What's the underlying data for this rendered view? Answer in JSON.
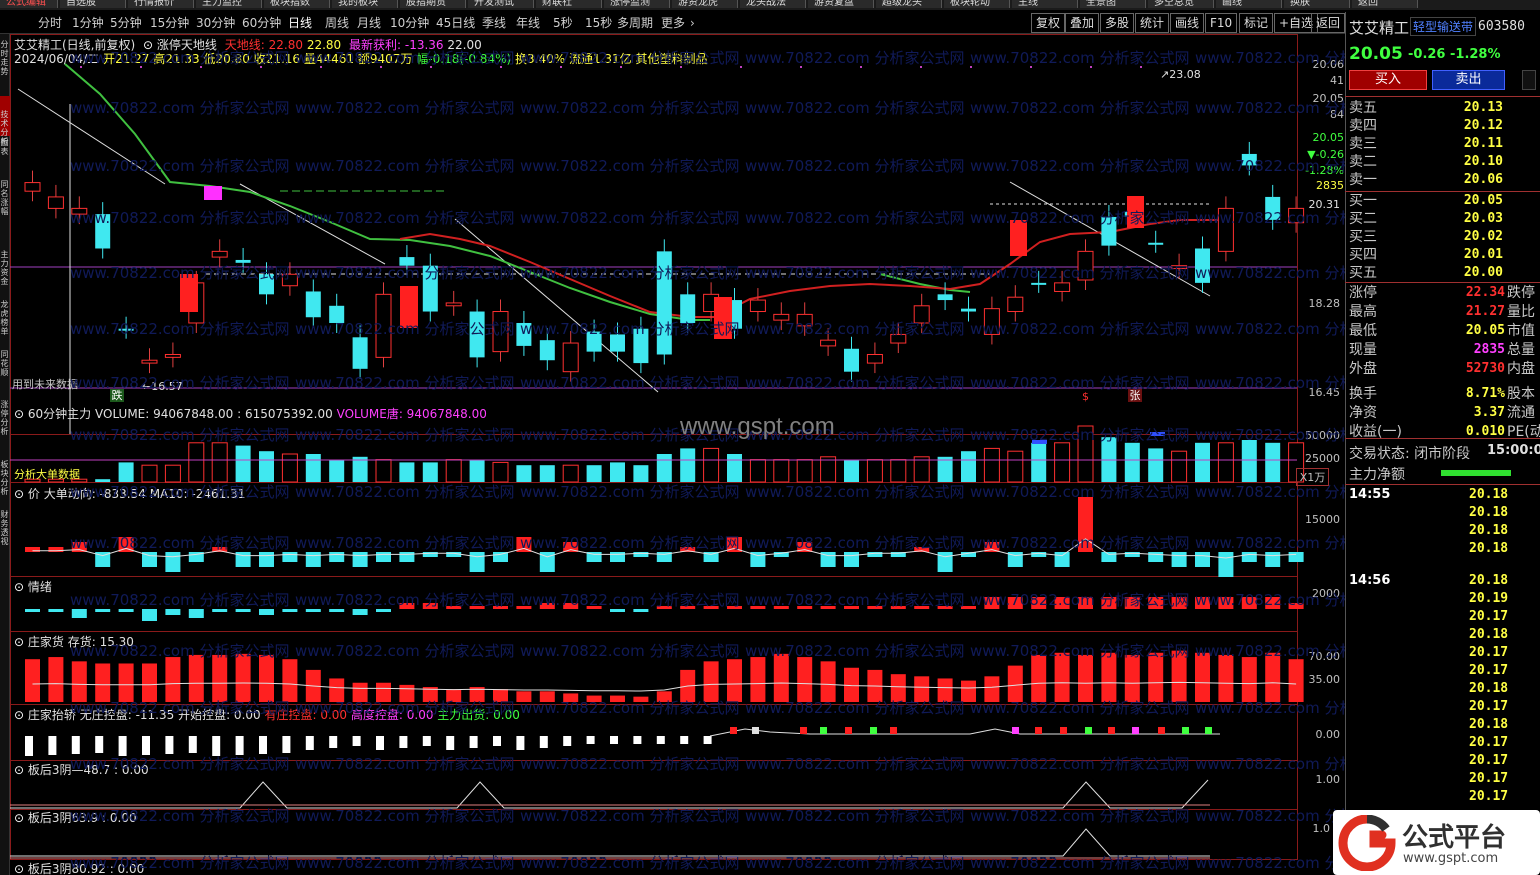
{
  "top_menu": [
    "公式编辑",
    "自选股",
    "行情报价",
    "主力监控",
    "板块指数",
    "我的板块",
    "股指期货",
    "开发测试",
    "财联社",
    "涨停监测",
    "游资龙虎",
    "龙头战法",
    "游资复盘",
    "超级龙头",
    "板块轮动",
    "主线",
    "全景图",
    "多空总览",
    "画线",
    "换肤",
    "返回"
  ],
  "period_tabs": [
    "分时",
    "1分钟",
    "5分钟",
    "15分钟",
    "30分钟",
    "60分钟",
    "日线",
    "周线",
    "月线",
    "10分钟",
    "45日线",
    "季线",
    "年线",
    "5秒",
    "15秒",
    "多周期",
    "更多"
  ],
  "right_buttons": [
    "复权",
    "叠加",
    "多股",
    "统计",
    "画线",
    "F10",
    "标记",
    "+自选",
    "返回"
  ],
  "left_strip": [
    "分时走势",
    "技术分析",
    "图表",
    "同名涨幅",
    "主力资金",
    "龙虎榜单",
    "同花顺",
    "涨停分析",
    "板块分析",
    "财务透视"
  ],
  "chart_header": {
    "name": "艾艾精工(日线,前复权)",
    "indicator": "涨停天地线",
    "tdx_label": "天地线:",
    "tdx_v1": "22.80",
    "tdx_v2": "22.80",
    "zxhl_label": "最新获利:",
    "zxhl_v": "-13.36",
    "zxhl_v2": "22.00"
  },
  "ohlc": {
    "date": "2024/06/04/二",
    "open_label": "开",
    "open": "21.27",
    "high_label": "高",
    "high": "21.33",
    "low_label": "低",
    "low": "20.80",
    "close_label": "收",
    "close": "21.16",
    "vol_label": "量",
    "vol": "44461",
    "amt_label": "额",
    "amt": "9407万",
    "chg_label": "幅",
    "chg": "-0.18(-0.84%)",
    "turn": "换3.40%",
    "float": "流通1.31亿",
    "industry": "其他塑料制品"
  },
  "annotations": {
    "high_mark": "23.08",
    "low_mark": "16.57",
    "future_data": "用到未来数据",
    "die": "跌",
    "zhang": "张",
    "s_mark": "$"
  },
  "y_axis_main": [
    "20.06",
    "41",
    "20.05",
    "84",
    "20.05",
    "-0.26",
    "-1.28%",
    "2835",
    "20.31",
    "18.28",
    "16.45"
  ],
  "panels": {
    "p1": {
      "title": "60分钟主力",
      "vol_label": "VOLUME: 94067848.00 : 615075392.00",
      "vol_tang": "VOLUME唐: 94067848.00",
      "extra": "分析大单数据",
      "y": [
        "50000",
        "25000"
      ],
      "x_unit": "X1万"
    },
    "p2": {
      "title": "价 大单动向: -833.54 MA10: -2461.31",
      "y": [
        "15000"
      ]
    },
    "p3": {
      "title": "情绪",
      "y": [
        "2000"
      ]
    },
    "p4": {
      "title": "庄家货 存货: 15.30",
      "y": [
        "70.00",
        "35.00"
      ]
    },
    "p5": {
      "title": "庄家抬轿 无庄控盘: -11.35",
      "a": "开始控盘: 0.00",
      "b": "有庄控盘: 0.00",
      "c": "高度控盘: 0.00",
      "d": "主力出货: 0.00",
      "y": [
        "0.00"
      ]
    },
    "p6": {
      "title": "板后3阴—48.7 : 0.00",
      "y": [
        "1.00"
      ]
    },
    "p7": {
      "title": "板后3阴63.9 : 0.00",
      "y": [
        "1.0"
      ]
    },
    "p8": {
      "title": "板后3阴80.92 : 0.00"
    }
  },
  "watermarks": [
    "www.70822.com 分析家公式网",
    "www.gspt.com"
  ],
  "quote": {
    "name": "艾艾精工",
    "tag": "轻型输送带",
    "code": "603580",
    "price": "20.05",
    "chg": "-0.26",
    "pct": "-1.28%",
    "buy_btn": "买入",
    "sell_btn": "卖出",
    "asks": [
      {
        "n": "卖五",
        "v": "20.13"
      },
      {
        "n": "卖四",
        "v": "20.12"
      },
      {
        "n": "卖三",
        "v": "20.11"
      },
      {
        "n": "卖二",
        "v": "20.10"
      },
      {
        "n": "卖一",
        "v": "20.06"
      }
    ],
    "bids": [
      {
        "n": "买一",
        "v": "20.05"
      },
      {
        "n": "买二",
        "v": "20.03"
      },
      {
        "n": "买三",
        "v": "20.02"
      },
      {
        "n": "买四",
        "v": "20.01"
      },
      {
        "n": "买五",
        "v": "20.00"
      }
    ],
    "stats": [
      {
        "n": "涨停",
        "v": "22.34",
        "c": "#ff3030",
        "n2": "跌停"
      },
      {
        "n": "最高",
        "v": "21.27",
        "c": "#ff3030",
        "n2": "量比"
      },
      {
        "n": "最低",
        "v": "20.05",
        "c": "#ffff44",
        "n2": "市值"
      },
      {
        "n": "现量",
        "v": "2835",
        "c": "#ff40ff",
        "n2": "总量"
      },
      {
        "n": "外盘",
        "v": "52730",
        "c": "#ff3030",
        "n2": "内盘"
      },
      {
        "n": "换手",
        "v": "8.71%",
        "c": "#ffff44",
        "n2": "股本"
      },
      {
        "n": "净资",
        "v": "3.37",
        "c": "#ffff44",
        "n2": "流通"
      },
      {
        "n": "收益(一)",
        "v": "0.010",
        "c": "#ffff44",
        "n2": "PE(动)"
      }
    ],
    "state": "交易状态: 闭市阶段",
    "state_time": "15:00:0",
    "main_net": "主力净额",
    "ticks": [
      {
        "t": "14:55",
        "v": "20.18"
      },
      {
        "t": "",
        "v": "20.18"
      },
      {
        "t": "",
        "v": "20.18"
      },
      {
        "t": "",
        "v": "20.18"
      },
      {
        "t": "14:56",
        "v": "20.18"
      },
      {
        "t": "",
        "v": "20.19"
      },
      {
        "t": "",
        "v": "20.17"
      },
      {
        "t": "",
        "v": "20.18"
      },
      {
        "t": "",
        "v": "20.17"
      },
      {
        "t": "",
        "v": "20.17"
      },
      {
        "t": "",
        "v": "20.18"
      },
      {
        "t": "",
        "v": "20.17"
      },
      {
        "t": "",
        "v": "20.18"
      },
      {
        "t": "",
        "v": "20.17"
      },
      {
        "t": "",
        "v": "20.17"
      },
      {
        "t": "",
        "v": "20.17"
      },
      {
        "t": "",
        "v": "20.17"
      }
    ]
  },
  "logo": {
    "name": "公式平台",
    "url": "www.gspt.com"
  },
  "chart_data": {
    "type": "candlestick",
    "candles": [
      {
        "o": 19.9,
        "c": 20.05
      },
      {
        "o": 19.6,
        "c": 19.8
      },
      {
        "o": 19.5,
        "c": 19.6
      },
      {
        "o": 19.5,
        "c": 18.9
      },
      {
        "o": 17.5,
        "c": 17.5
      },
      {
        "o": 16.9,
        "c": 16.95
      },
      {
        "o": 17.0,
        "c": 17.05
      },
      {
        "o": 17.6,
        "c": 18.3
      },
      {
        "o": 18.75,
        "c": 18.85
      },
      {
        "o": 18.7,
        "c": 18.65
      },
      {
        "o": 18.45,
        "c": 18.1
      },
      {
        "o": 18.25,
        "c": 18.45
      },
      {
        "o": 18.15,
        "c": 17.7
      },
      {
        "o": 17.9,
        "c": 17.6
      },
      {
        "o": 17.35,
        "c": 16.8
      },
      {
        "o": 17.0,
        "c": 18.1
      },
      {
        "o": 18.75,
        "c": 18.6
      },
      {
        "o": 18.6,
        "c": 17.8
      },
      {
        "o": 17.9,
        "c": 17.95
      },
      {
        "o": 17.8,
        "c": 17.0
      },
      {
        "o": 17.1,
        "c": 17.8
      },
      {
        "o": 17.6,
        "c": 17.2
      },
      {
        "o": 17.3,
        "c": 16.95
      },
      {
        "o": 16.75,
        "c": 17.25
      },
      {
        "o": 17.45,
        "c": 17.1
      },
      {
        "o": 17.4,
        "c": 17.1
      },
      {
        "o": 17.5,
        "c": 16.9
      },
      {
        "o": 18.85,
        "c": 17.05
      },
      {
        "o": 18.1,
        "c": 17.6
      },
      {
        "o": 17.8,
        "c": 18.1
      },
      {
        "o": 18.0,
        "c": 17.5
      },
      {
        "o": 17.8,
        "c": 18.0
      },
      {
        "o": 17.65,
        "c": 17.75
      },
      {
        "o": 17.55,
        "c": 17.75
      },
      {
        "o": 17.2,
        "c": 17.3
      },
      {
        "o": 17.15,
        "c": 16.75
      },
      {
        "o": 16.9,
        "c": 17.05
      },
      {
        "o": 17.25,
        "c": 17.4
      },
      {
        "o": 17.6,
        "c": 17.9
      },
      {
        "o": 18.1,
        "c": 18.0
      },
      {
        "o": 17.85,
        "c": 17.8
      },
      {
        "o": 17.4,
        "c": 17.85
      },
      {
        "o": 17.8,
        "c": 18.05
      },
      {
        "o": 18.3,
        "c": 18.3
      },
      {
        "o": 18.15,
        "c": 18.3
      },
      {
        "o": 18.35,
        "c": 18.85
      },
      {
        "o": 19.45,
        "c": 18.95
      },
      {
        "o": 19.55,
        "c": 19.45
      },
      {
        "o": 19.0,
        "c": 19.0
      },
      {
        "o": 18.55,
        "c": 18.6
      },
      {
        "o": 18.9,
        "c": 18.3
      },
      {
        "o": 18.85,
        "c": 19.6
      },
      {
        "o": 20.55,
        "c": 20.35
      },
      {
        "o": 19.8,
        "c": 19.4
      },
      {
        "o": 19.35,
        "c": 19.6
      }
    ],
    "volume": [
      1,
      1,
      1,
      1,
      7,
      6,
      6,
      14,
      14,
      13,
      11,
      10,
      10,
      8,
      9,
      8,
      7,
      7,
      8,
      8,
      7,
      6,
      6,
      6,
      6,
      7,
      6,
      10,
      12,
      12,
      10,
      8,
      8,
      8,
      9,
      8,
      8,
      8,
      9,
      9,
      11,
      12,
      11,
      14,
      14,
      20,
      16,
      14,
      12,
      11,
      14,
      14,
      15,
      14,
      14
    ],
    "big_order": [
      1,
      1,
      2,
      -3,
      3,
      -3,
      -4,
      -2,
      1,
      -3,
      -3,
      -2,
      -3,
      -2,
      -3,
      -2,
      -2,
      -1,
      -1,
      -4,
      -2,
      3,
      -4,
      2,
      -2,
      -2,
      -1,
      -2,
      1,
      -2,
      3,
      -3,
      -1,
      2,
      -3,
      -3,
      -1,
      -1,
      1,
      -4,
      -1,
      2,
      -3,
      -1,
      -3,
      11,
      -2,
      -1,
      -2,
      -3,
      -3,
      -5,
      -2,
      -3,
      -2
    ],
    "emotion": [
      -1,
      -1,
      -3,
      -1,
      -1,
      -4,
      -2,
      -3,
      -1,
      -1,
      -2,
      -1,
      -1,
      -1,
      -2,
      -1,
      2,
      2,
      1,
      1,
      1,
      1,
      2,
      2,
      1,
      -1,
      -1,
      1,
      1,
      1,
      1,
      1,
      1,
      1,
      1,
      1,
      1,
      1,
      1,
      1,
      1,
      4,
      4,
      4,
      4,
      4,
      4,
      4,
      4,
      4,
      4,
      4,
      4,
      4,
      2
    ],
    "zhuang": [
      40,
      42,
      38,
      36,
      36,
      36,
      42,
      44,
      44,
      45,
      44,
      40,
      30,
      22,
      18,
      18,
      16,
      14,
      12,
      14,
      12,
      10,
      10,
      8,
      6,
      6,
      5,
      10,
      30,
      38,
      40,
      42,
      45,
      42,
      38,
      32,
      30,
      26,
      24,
      22,
      20,
      24,
      34,
      44,
      46,
      44,
      46,
      44,
      46,
      48,
      46,
      44,
      42,
      46,
      40
    ]
  }
}
